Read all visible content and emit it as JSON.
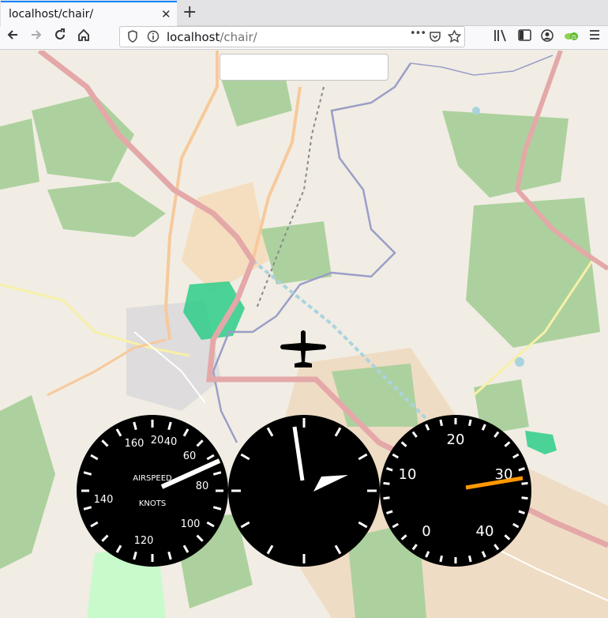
{
  "browser": {
    "tab_title": "localhost/chair/",
    "close_glyph": "✕",
    "new_tab_glyph": "+",
    "url_host": "localhost",
    "url_path": "/chair/",
    "url_dots": "•••"
  },
  "map": {
    "search_value": "",
    "colors": {
      "land": "#f1ede4",
      "forest": "#add19e",
      "park": "#c8facc",
      "farmyard": "#f5dcba",
      "primary_road": "#e4a8a8",
      "secondary_road": "#f7c99b",
      "water": "#aad3df",
      "river": "#9a9ec8",
      "wetland": "#2ecc8a"
    }
  },
  "aircraft": {
    "icon": "airplane-icon",
    "heading": 0
  },
  "instruments": {
    "airspeed": {
      "label_top": "AIRSPEED",
      "label_bottom": "KNOTS",
      "scale_labels": [
        "20",
        "40",
        "60",
        "80",
        "100",
        "120",
        "140",
        "160"
      ],
      "needle_value": 67
    },
    "attitude": {
      "needle_value": 0.97
    },
    "altimeter": {
      "scale_labels": [
        "0",
        "10",
        "20",
        "30",
        "40"
      ],
      "needle_value": 32,
      "needle_color": "#ff9800"
    }
  }
}
